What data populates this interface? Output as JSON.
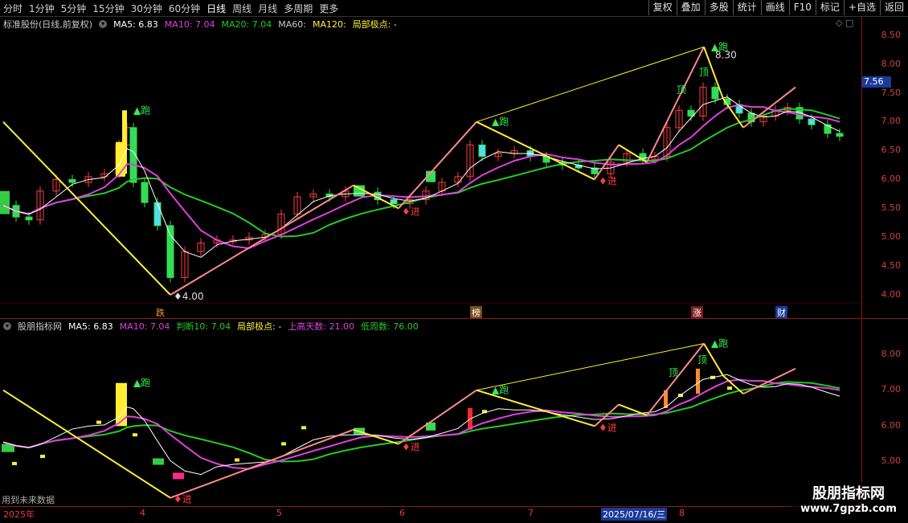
{
  "toolbar": {
    "periods": [
      "分时",
      "1分钟",
      "5分钟",
      "15分钟",
      "30分钟",
      "60分钟",
      "日线",
      "周线",
      "月线",
      "多周期",
      "更多"
    ],
    "active_period": "日线",
    "right_buttons": [
      "复权",
      "叠加",
      "多股",
      "统计",
      "画线",
      "F10",
      "标记",
      "+自选",
      "返回"
    ]
  },
  "main_panel": {
    "title": "标准股份(日线,前复权)",
    "ma5": "MA5: 6.83",
    "ma10": "MA10: 7.04",
    "ma20": "MA20: 7.04",
    "ma60": "MA60:",
    "ma120": "MA120:",
    "extreme": "局部极点: -",
    "axis_ticks": [
      "8.50",
      "8.00",
      "7.50",
      "7.00",
      "6.50",
      "6.00",
      "5.50",
      "5.00",
      "4.50",
      "4.00"
    ],
    "current_price": "7.56",
    "high_label": "8.30",
    "low_label": "4.00",
    "event_tags": [
      "跌",
      "榜",
      "涨",
      "财"
    ]
  },
  "sub_panel": {
    "title": "股朋指标网",
    "ma5": "MA5: 6.83",
    "ma10": "MA10: 7.04",
    "judge": "判断10: 7.04",
    "extreme": "局部极点: -",
    "up_days": "上高天数: 21.00",
    "low_weeks": "低周数: 76.00",
    "axis_ticks": [
      "8.00",
      "7.00",
      "6.00",
      "5.00"
    ]
  },
  "signals": {
    "run": "跑",
    "enter": "进",
    "top": "顶"
  },
  "bottom": {
    "months": [
      "2025年",
      "4",
      "5",
      "6",
      "7",
      "8"
    ],
    "cursor_date": "2025/07/16/三",
    "note": "用到未来数据"
  },
  "watermark": {
    "line1": "股朋指标网",
    "line2": "www.7gpzb.com"
  },
  "colors": {
    "up": "#ff3b3b",
    "down": "#33dd55",
    "ma5": "#ffffff",
    "ma10": "#e040e0",
    "ma20": "#22cc22",
    "zigzag": "#ffee33",
    "zigzag_up": "#ff8a8a",
    "ma120": "#ffee33"
  }
}
